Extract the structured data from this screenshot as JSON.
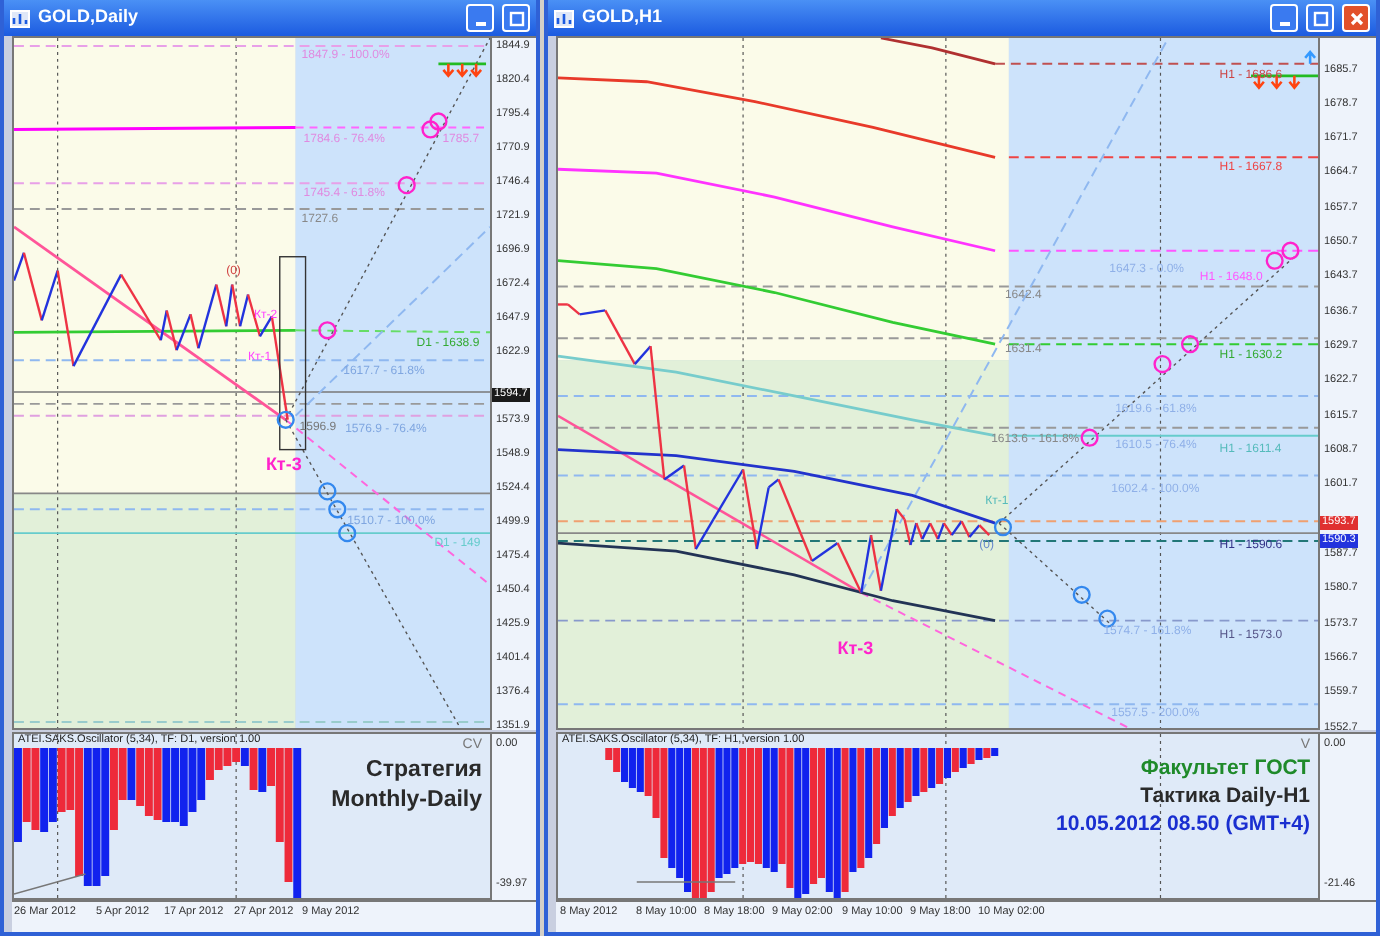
{
  "windows": [
    {
      "title": "GOLD,Daily",
      "price_axis": [
        {
          "text": "1844.9",
          "kind": "tick"
        },
        {
          "text": "1820.4",
          "kind": "tick"
        },
        {
          "text": "1795.4",
          "kind": "tick"
        },
        {
          "text": "1770.9",
          "kind": "tick"
        },
        {
          "text": "1746.4",
          "kind": "tick"
        },
        {
          "text": "1721.9",
          "kind": "tick"
        },
        {
          "text": "1696.9",
          "kind": "tick"
        },
        {
          "text": "1672.4",
          "kind": "tick"
        },
        {
          "text": "1647.9",
          "kind": "tick"
        },
        {
          "text": "1622.9",
          "kind": "tick"
        },
        {
          "text": "1594.7",
          "kind": "current",
          "color": "#1a1a1a"
        },
        {
          "text": "1573.9",
          "kind": "tick"
        },
        {
          "text": "1548.9",
          "kind": "tick"
        },
        {
          "text": "1524.4",
          "kind": "tick"
        },
        {
          "text": "1499.9",
          "kind": "tick"
        },
        {
          "text": "1475.4",
          "kind": "tick"
        },
        {
          "text": "1450.4",
          "kind": "tick"
        },
        {
          "text": "1425.9",
          "kind": "tick"
        },
        {
          "text": "1401.4",
          "kind": "tick"
        },
        {
          "text": "1376.4",
          "kind": "tick"
        },
        {
          "text": "1351.9",
          "kind": "tick"
        }
      ],
      "annotations": [
        {
          "text": "1847.9 - 100.0%",
          "kind": "level",
          "color": "#e08ae0"
        },
        {
          "text": "1784.6 - 76.4%",
          "kind": "level",
          "color": "#e08ae0"
        },
        {
          "text": "1785.7",
          "kind": "level",
          "color": "#e08ae0"
        },
        {
          "text": "1745.4 - 61.8%",
          "kind": "level",
          "color": "#e08ae0"
        },
        {
          "text": "1727.6",
          "kind": "level",
          "color": "#888888"
        },
        {
          "text": "(0)",
          "kind": "wave",
          "color": "#d04040"
        },
        {
          "text": "Кт-2",
          "kind": "wave",
          "color": "#ff44ff"
        },
        {
          "text": "Кт-1",
          "kind": "wave",
          "color": "#ff44ff"
        },
        {
          "text": "D1 - 1638.9",
          "kind": "level",
          "color": "#33aa33"
        },
        {
          "text": "1617.7 - 61.8%",
          "kind": "level",
          "color": "#7fa6e0"
        },
        {
          "text": "1596.9",
          "kind": "level",
          "color": "#777777"
        },
        {
          "text": "1576.9 - 76.4%",
          "kind": "level",
          "color": "#7fa6e0"
        },
        {
          "text": "Кт-3",
          "kind": "big-wave",
          "color": "#ff22cc"
        },
        {
          "text": "1510.7 - 100.0%",
          "kind": "level",
          "color": "#7fa6e0"
        },
        {
          "text": "D1 - 149",
          "kind": "level",
          "color": "#66cccc"
        }
      ],
      "oscillator": {
        "label": "ATEI.SAKS.Oscillator (5,34), TF: D1, version 1.00",
        "max": "0.00",
        "min": "-39.97",
        "marker": "CV"
      },
      "captions": [
        {
          "text": "Стратегия",
          "color": "#2a2a2a"
        },
        {
          "text": "Monthly-Daily",
          "color": "#2a2a2a"
        }
      ],
      "dates": [
        "26 Mar 2012",
        "5 Apr 2012",
        "17 Apr 2012",
        "27 Apr 2012",
        "9 May 2012"
      ]
    },
    {
      "title": "GOLD,H1",
      "price_axis": [
        {
          "text": "1685.7",
          "kind": "tick"
        },
        {
          "text": "1678.7",
          "kind": "tick"
        },
        {
          "text": "1671.7",
          "kind": "tick"
        },
        {
          "text": "1664.7",
          "kind": "tick"
        },
        {
          "text": "1657.7",
          "kind": "tick"
        },
        {
          "text": "1650.7",
          "kind": "tick"
        },
        {
          "text": "1643.7",
          "kind": "tick"
        },
        {
          "text": "1636.7",
          "kind": "tick"
        },
        {
          "text": "1629.7",
          "kind": "tick"
        },
        {
          "text": "1622.7",
          "kind": "tick"
        },
        {
          "text": "1615.7",
          "kind": "tick"
        },
        {
          "text": "1608.7",
          "kind": "tick"
        },
        {
          "text": "1601.7",
          "kind": "tick"
        },
        {
          "text": "1593.7",
          "kind": "current",
          "color": "#e03030"
        },
        {
          "text": "1590.3",
          "kind": "current",
          "color": "#2233dd"
        },
        {
          "text": "1587.7",
          "kind": "tick"
        },
        {
          "text": "1580.7",
          "kind": "tick"
        },
        {
          "text": "1573.7",
          "kind": "tick"
        },
        {
          "text": "1566.7",
          "kind": "tick"
        },
        {
          "text": "1559.7",
          "kind": "tick"
        },
        {
          "text": "1552.7",
          "kind": "tick"
        }
      ],
      "annotations": [
        {
          "text": "H1 - 1686.6",
          "kind": "level",
          "color": "#cc4444"
        },
        {
          "text": "H1 - 1667.8",
          "kind": "level",
          "color": "#ee4444"
        },
        {
          "text": "H1 - 1648.0",
          "kind": "level",
          "color": "#ff55ff"
        },
        {
          "text": "1647.3 - 0.0%",
          "kind": "level",
          "color": "#8fb0e8"
        },
        {
          "text": "1642.4",
          "kind": "level",
          "color": "#888888"
        },
        {
          "text": "1631.4",
          "kind": "level",
          "color": "#888888"
        },
        {
          "text": "H1 - 1630.2",
          "kind": "level",
          "color": "#33aa33"
        },
        {
          "text": "1619.6 - 61.8%",
          "kind": "level",
          "color": "#8fb0e8"
        },
        {
          "text": "1613.6 - 161.8%",
          "kind": "level",
          "color": "#888888"
        },
        {
          "text": "1610.5 - 76.4%",
          "kind": "level",
          "color": "#8fb0e8"
        },
        {
          "text": "H1 - 1611.4",
          "kind": "level",
          "color": "#55bbbb"
        },
        {
          "text": "1602.4 - 100.0%",
          "kind": "level",
          "color": "#8fb0e8"
        },
        {
          "text": "Кт-1",
          "kind": "wave",
          "color": "#55bbbb"
        },
        {
          "text": "(0)",
          "kind": "wave",
          "color": "#6688cc"
        },
        {
          "text": "H1 - 1590.6",
          "kind": "level",
          "color": "#333388"
        },
        {
          "text": "1574.7 - 161.8%",
          "kind": "level",
          "color": "#8fb0e8"
        },
        {
          "text": "H1 - 1573.0",
          "kind": "level",
          "color": "#555588"
        },
        {
          "text": "Кт-3",
          "kind": "big-wave",
          "color": "#ff22cc"
        },
        {
          "text": "1557.5 - 200.0%",
          "kind": "level",
          "color": "#8fb0e8"
        }
      ],
      "oscillator": {
        "label": "ATEI.SAKS.Oscillator (5,34), TF: H1, version 1.00",
        "max": "0.00",
        "min": "-21.46",
        "marker": "V"
      },
      "captions": [
        {
          "text": "Факультет ГОСТ",
          "color": "#1f8a2a"
        },
        {
          "text": "Тактика Daily-H1",
          "color": "#2a2a2a"
        },
        {
          "text": "10.05.2012 08.50 (GMT+4)",
          "color": "#1a2fd0"
        }
      ],
      "dates": [
        "8 May 2012",
        "8 May 10:00",
        "8 May 18:00",
        "9 May 02:00",
        "9 May 10:00",
        "9 May 18:00",
        "10 May 02:00"
      ]
    }
  ]
}
